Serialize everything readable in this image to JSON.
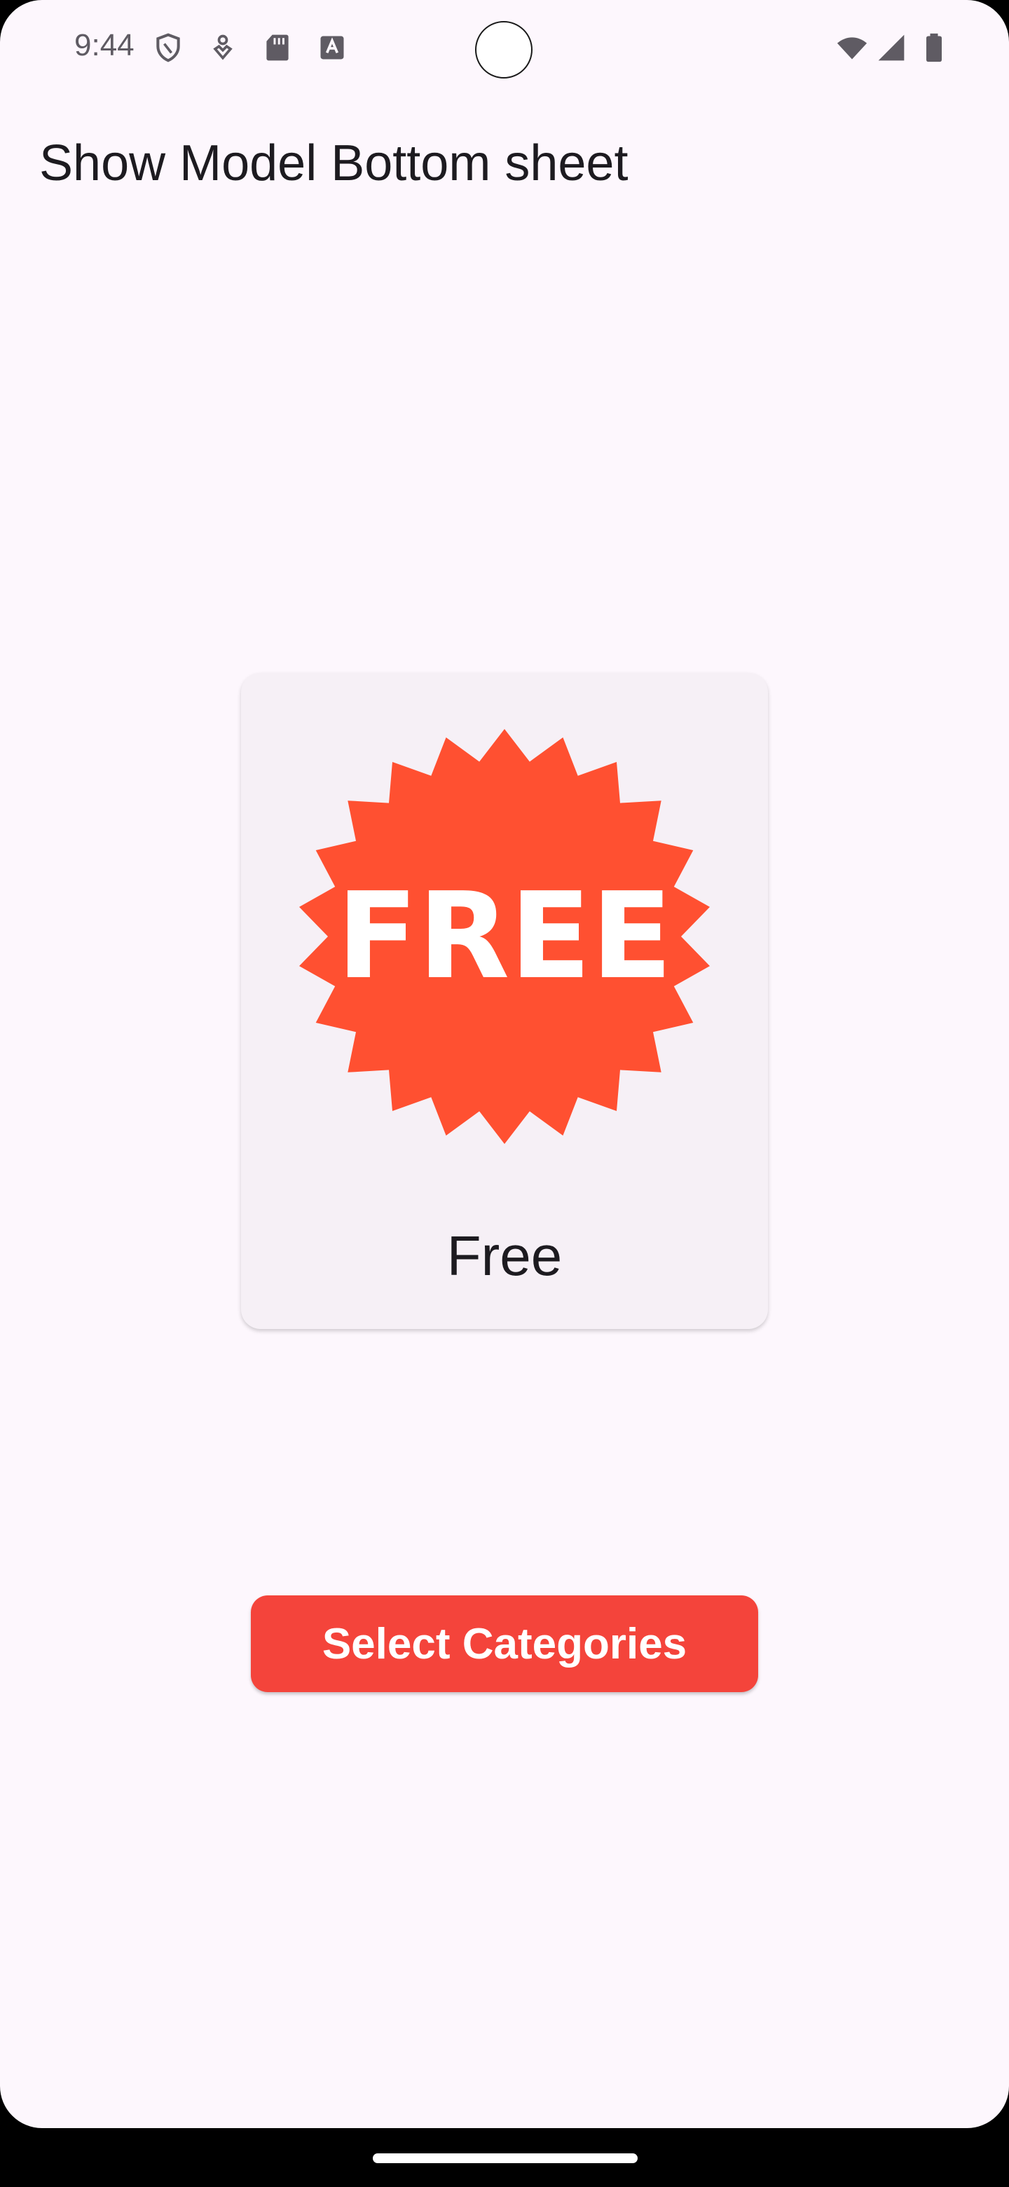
{
  "status_bar": {
    "time": "9:44",
    "left_icons": [
      "shield-icon",
      "pin-icon",
      "sd-card-icon",
      "keyboard-a-icon"
    ],
    "right_icons": [
      "wifi-icon",
      "cell-signal-icon",
      "battery-icon"
    ]
  },
  "page": {
    "title": "Show Model Bottom sheet"
  },
  "card": {
    "badge_text": "FREE",
    "label": "Free",
    "badge_color": "#ff5031"
  },
  "button": {
    "label": "Select Categories",
    "color": "#f4443b"
  },
  "colors": {
    "background": "#fdf7fd",
    "card_background": "#f6f0f6",
    "text": "#1d1b20"
  }
}
